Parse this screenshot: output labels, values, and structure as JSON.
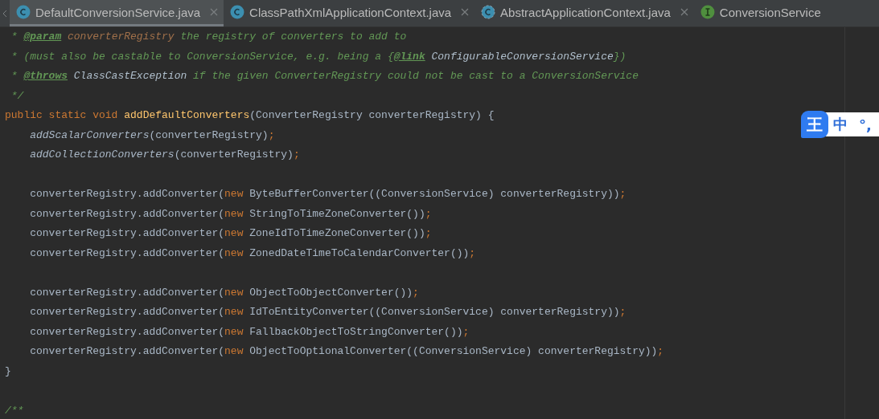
{
  "tabs": [
    {
      "label": "DefaultConversionService.java",
      "kind": "class",
      "selected": true,
      "closable": true
    },
    {
      "label": "ClassPathXmlApplicationContext.java",
      "kind": "class",
      "selected": false,
      "closable": true
    },
    {
      "label": "AbstractApplicationContext.java",
      "kind": "abstract",
      "selected": false,
      "closable": true
    },
    {
      "label": "ConversionService",
      "kind": "interface",
      "selected": false,
      "closable": false
    }
  ],
  "editor": {
    "lines": [
      {
        "kind": "code",
        "tokens": [
          {
            "kind": "comment",
            "text": " * "
          },
          {
            "kind": "doc-tag",
            "text": "@param"
          },
          {
            "kind": "doc-param",
            "text": " converterRegistry"
          },
          {
            "kind": "comment",
            "text": " the registry of converters to add to"
          }
        ]
      },
      {
        "kind": "code",
        "tokens": [
          {
            "kind": "comment",
            "text": " * (must also be castable to ConversionService, e.g. being a {"
          },
          {
            "kind": "doc-tag",
            "text": "@link"
          },
          {
            "kind": "doc-ref",
            "text": " ConfigurableConversionService"
          },
          {
            "kind": "comment",
            "text": "})"
          }
        ]
      },
      {
        "kind": "code",
        "tokens": [
          {
            "kind": "comment",
            "text": " * "
          },
          {
            "kind": "doc-tag",
            "text": "@throws"
          },
          {
            "kind": "doc-ref",
            "text": " ClassCastException"
          },
          {
            "kind": "comment",
            "text": " if the given ConverterRegistry could not be cast to a ConversionService"
          }
        ]
      },
      {
        "kind": "code",
        "tokens": [
          {
            "kind": "comment",
            "text": " */"
          }
        ]
      },
      {
        "kind": "code",
        "tokens": [
          {
            "kind": "keyword",
            "text": "public static void "
          },
          {
            "kind": "method",
            "text": "addDefaultConverters"
          },
          {
            "kind": "plain",
            "text": "(ConverterRegistry converterRegistry) {"
          }
        ]
      },
      {
        "kind": "code",
        "tokens": [
          {
            "kind": "static-call",
            "text": "    addScalarConverters"
          },
          {
            "kind": "plain",
            "text": "(converterRegistry)"
          },
          {
            "kind": "keyword",
            "text": ";"
          }
        ]
      },
      {
        "kind": "code",
        "tokens": [
          {
            "kind": "static-call",
            "text": "    addCollectionConverters"
          },
          {
            "kind": "plain",
            "text": "(converterRegistry)"
          },
          {
            "kind": "keyword",
            "text": ";"
          }
        ]
      },
      {
        "kind": "blank"
      },
      {
        "kind": "code",
        "tokens": [
          {
            "kind": "plain",
            "text": "    converterRegistry.addConverter("
          },
          {
            "kind": "keyword",
            "text": "new "
          },
          {
            "kind": "plain",
            "text": "ByteBufferConverter((ConversionService) converterRegistry))"
          },
          {
            "kind": "keyword",
            "text": ";"
          }
        ]
      },
      {
        "kind": "code",
        "tokens": [
          {
            "kind": "plain",
            "text": "    converterRegistry.addConverter("
          },
          {
            "kind": "keyword",
            "text": "new "
          },
          {
            "kind": "plain",
            "text": "StringToTimeZoneConverter())"
          },
          {
            "kind": "keyword",
            "text": ";"
          }
        ]
      },
      {
        "kind": "code",
        "tokens": [
          {
            "kind": "plain",
            "text": "    converterRegistry.addConverter("
          },
          {
            "kind": "keyword",
            "text": "new "
          },
          {
            "kind": "plain",
            "text": "ZoneIdToTimeZoneConverter())"
          },
          {
            "kind": "keyword",
            "text": ";"
          }
        ]
      },
      {
        "kind": "code",
        "tokens": [
          {
            "kind": "plain",
            "text": "    converterRegistry.addConverter("
          },
          {
            "kind": "keyword",
            "text": "new "
          },
          {
            "kind": "plain",
            "text": "ZonedDateTimeToCalendarConverter())"
          },
          {
            "kind": "keyword",
            "text": ";"
          }
        ]
      },
      {
        "kind": "blank"
      },
      {
        "kind": "code",
        "tokens": [
          {
            "kind": "plain",
            "text": "    converterRegistry.addConverter("
          },
          {
            "kind": "keyword",
            "text": "new "
          },
          {
            "kind": "plain",
            "text": "ObjectToObjectConverter())"
          },
          {
            "kind": "keyword",
            "text": ";"
          }
        ]
      },
      {
        "kind": "code",
        "tokens": [
          {
            "kind": "plain",
            "text": "    converterRegistry.addConverter("
          },
          {
            "kind": "keyword",
            "text": "new "
          },
          {
            "kind": "plain",
            "text": "IdToEntityConverter((ConversionService) converterRegistry))"
          },
          {
            "kind": "keyword",
            "text": ";"
          }
        ]
      },
      {
        "kind": "code",
        "tokens": [
          {
            "kind": "plain",
            "text": "    converterRegistry.addConverter("
          },
          {
            "kind": "keyword",
            "text": "new "
          },
          {
            "kind": "plain",
            "text": "FallbackObjectToStringConverter())"
          },
          {
            "kind": "keyword",
            "text": ";"
          }
        ]
      },
      {
        "kind": "code",
        "tokens": [
          {
            "kind": "plain",
            "text": "    converterRegistry.addConverter("
          },
          {
            "kind": "keyword",
            "text": "new "
          },
          {
            "kind": "plain",
            "text": "ObjectToOptionalConverter((ConversionService) converterRegistry))"
          },
          {
            "kind": "keyword",
            "text": ";"
          }
        ]
      },
      {
        "kind": "code",
        "tokens": [
          {
            "kind": "plain",
            "text": "}"
          }
        ]
      },
      {
        "kind": "blank"
      },
      {
        "kind": "code",
        "tokens": [
          {
            "kind": "comment",
            "text": "/**"
          }
        ]
      }
    ]
  },
  "ime": {
    "logo": "王",
    "mode": "中",
    "punctuation": "°,"
  }
}
